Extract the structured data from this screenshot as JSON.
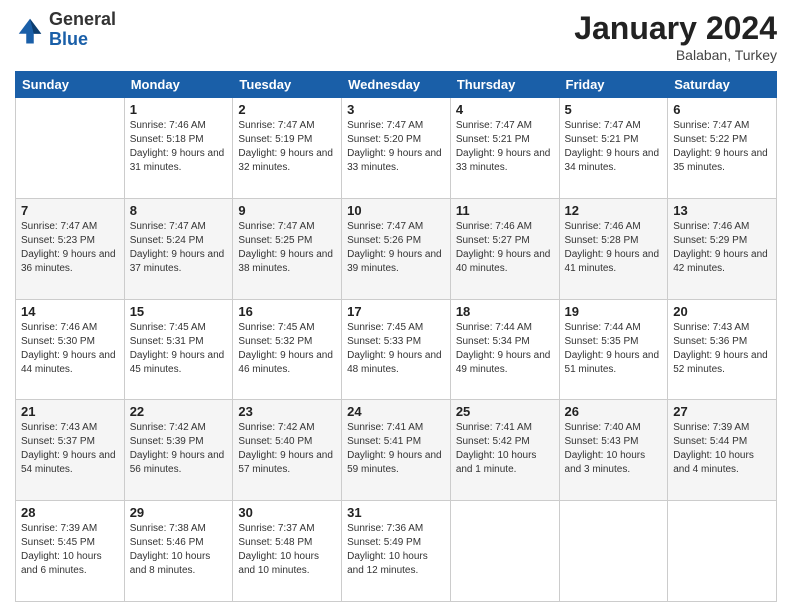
{
  "header": {
    "logo": {
      "line1": "General",
      "line2": "Blue"
    },
    "title": "January 2024",
    "subtitle": "Balaban, Turkey"
  },
  "weekdays": [
    "Sunday",
    "Monday",
    "Tuesday",
    "Wednesday",
    "Thursday",
    "Friday",
    "Saturday"
  ],
  "weeks": [
    [
      {
        "day": "",
        "sunrise": "",
        "sunset": "",
        "daylight": ""
      },
      {
        "day": "1",
        "sunrise": "7:46 AM",
        "sunset": "5:18 PM",
        "daylight": "9 hours and 31 minutes."
      },
      {
        "day": "2",
        "sunrise": "7:47 AM",
        "sunset": "5:19 PM",
        "daylight": "9 hours and 32 minutes."
      },
      {
        "day": "3",
        "sunrise": "7:47 AM",
        "sunset": "5:20 PM",
        "daylight": "9 hours and 33 minutes."
      },
      {
        "day": "4",
        "sunrise": "7:47 AM",
        "sunset": "5:21 PM",
        "daylight": "9 hours and 33 minutes."
      },
      {
        "day": "5",
        "sunrise": "7:47 AM",
        "sunset": "5:21 PM",
        "daylight": "9 hours and 34 minutes."
      },
      {
        "day": "6",
        "sunrise": "7:47 AM",
        "sunset": "5:22 PM",
        "daylight": "9 hours and 35 minutes."
      }
    ],
    [
      {
        "day": "7",
        "sunrise": "7:47 AM",
        "sunset": "5:23 PM",
        "daylight": "9 hours and 36 minutes."
      },
      {
        "day": "8",
        "sunrise": "7:47 AM",
        "sunset": "5:24 PM",
        "daylight": "9 hours and 37 minutes."
      },
      {
        "day": "9",
        "sunrise": "7:47 AM",
        "sunset": "5:25 PM",
        "daylight": "9 hours and 38 minutes."
      },
      {
        "day": "10",
        "sunrise": "7:47 AM",
        "sunset": "5:26 PM",
        "daylight": "9 hours and 39 minutes."
      },
      {
        "day": "11",
        "sunrise": "7:46 AM",
        "sunset": "5:27 PM",
        "daylight": "9 hours and 40 minutes."
      },
      {
        "day": "12",
        "sunrise": "7:46 AM",
        "sunset": "5:28 PM",
        "daylight": "9 hours and 41 minutes."
      },
      {
        "day": "13",
        "sunrise": "7:46 AM",
        "sunset": "5:29 PM",
        "daylight": "9 hours and 42 minutes."
      }
    ],
    [
      {
        "day": "14",
        "sunrise": "7:46 AM",
        "sunset": "5:30 PM",
        "daylight": "9 hours and 44 minutes."
      },
      {
        "day": "15",
        "sunrise": "7:45 AM",
        "sunset": "5:31 PM",
        "daylight": "9 hours and 45 minutes."
      },
      {
        "day": "16",
        "sunrise": "7:45 AM",
        "sunset": "5:32 PM",
        "daylight": "9 hours and 46 minutes."
      },
      {
        "day": "17",
        "sunrise": "7:45 AM",
        "sunset": "5:33 PM",
        "daylight": "9 hours and 48 minutes."
      },
      {
        "day": "18",
        "sunrise": "7:44 AM",
        "sunset": "5:34 PM",
        "daylight": "9 hours and 49 minutes."
      },
      {
        "day": "19",
        "sunrise": "7:44 AM",
        "sunset": "5:35 PM",
        "daylight": "9 hours and 51 minutes."
      },
      {
        "day": "20",
        "sunrise": "7:43 AM",
        "sunset": "5:36 PM",
        "daylight": "9 hours and 52 minutes."
      }
    ],
    [
      {
        "day": "21",
        "sunrise": "7:43 AM",
        "sunset": "5:37 PM",
        "daylight": "9 hours and 54 minutes."
      },
      {
        "day": "22",
        "sunrise": "7:42 AM",
        "sunset": "5:39 PM",
        "daylight": "9 hours and 56 minutes."
      },
      {
        "day": "23",
        "sunrise": "7:42 AM",
        "sunset": "5:40 PM",
        "daylight": "9 hours and 57 minutes."
      },
      {
        "day": "24",
        "sunrise": "7:41 AM",
        "sunset": "5:41 PM",
        "daylight": "9 hours and 59 minutes."
      },
      {
        "day": "25",
        "sunrise": "7:41 AM",
        "sunset": "5:42 PM",
        "daylight": "10 hours and 1 minute."
      },
      {
        "day": "26",
        "sunrise": "7:40 AM",
        "sunset": "5:43 PM",
        "daylight": "10 hours and 3 minutes."
      },
      {
        "day": "27",
        "sunrise": "7:39 AM",
        "sunset": "5:44 PM",
        "daylight": "10 hours and 4 minutes."
      }
    ],
    [
      {
        "day": "28",
        "sunrise": "7:39 AM",
        "sunset": "5:45 PM",
        "daylight": "10 hours and 6 minutes."
      },
      {
        "day": "29",
        "sunrise": "7:38 AM",
        "sunset": "5:46 PM",
        "daylight": "10 hours and 8 minutes."
      },
      {
        "day": "30",
        "sunrise": "7:37 AM",
        "sunset": "5:48 PM",
        "daylight": "10 hours and 10 minutes."
      },
      {
        "day": "31",
        "sunrise": "7:36 AM",
        "sunset": "5:49 PM",
        "daylight": "10 hours and 12 minutes."
      },
      {
        "day": "",
        "sunrise": "",
        "sunset": "",
        "daylight": ""
      },
      {
        "day": "",
        "sunrise": "",
        "sunset": "",
        "daylight": ""
      },
      {
        "day": "",
        "sunrise": "",
        "sunset": "",
        "daylight": ""
      }
    ]
  ],
  "labels": {
    "sunrise_prefix": "Sunrise: ",
    "sunset_prefix": "Sunset: ",
    "daylight_prefix": "Daylight: "
  }
}
